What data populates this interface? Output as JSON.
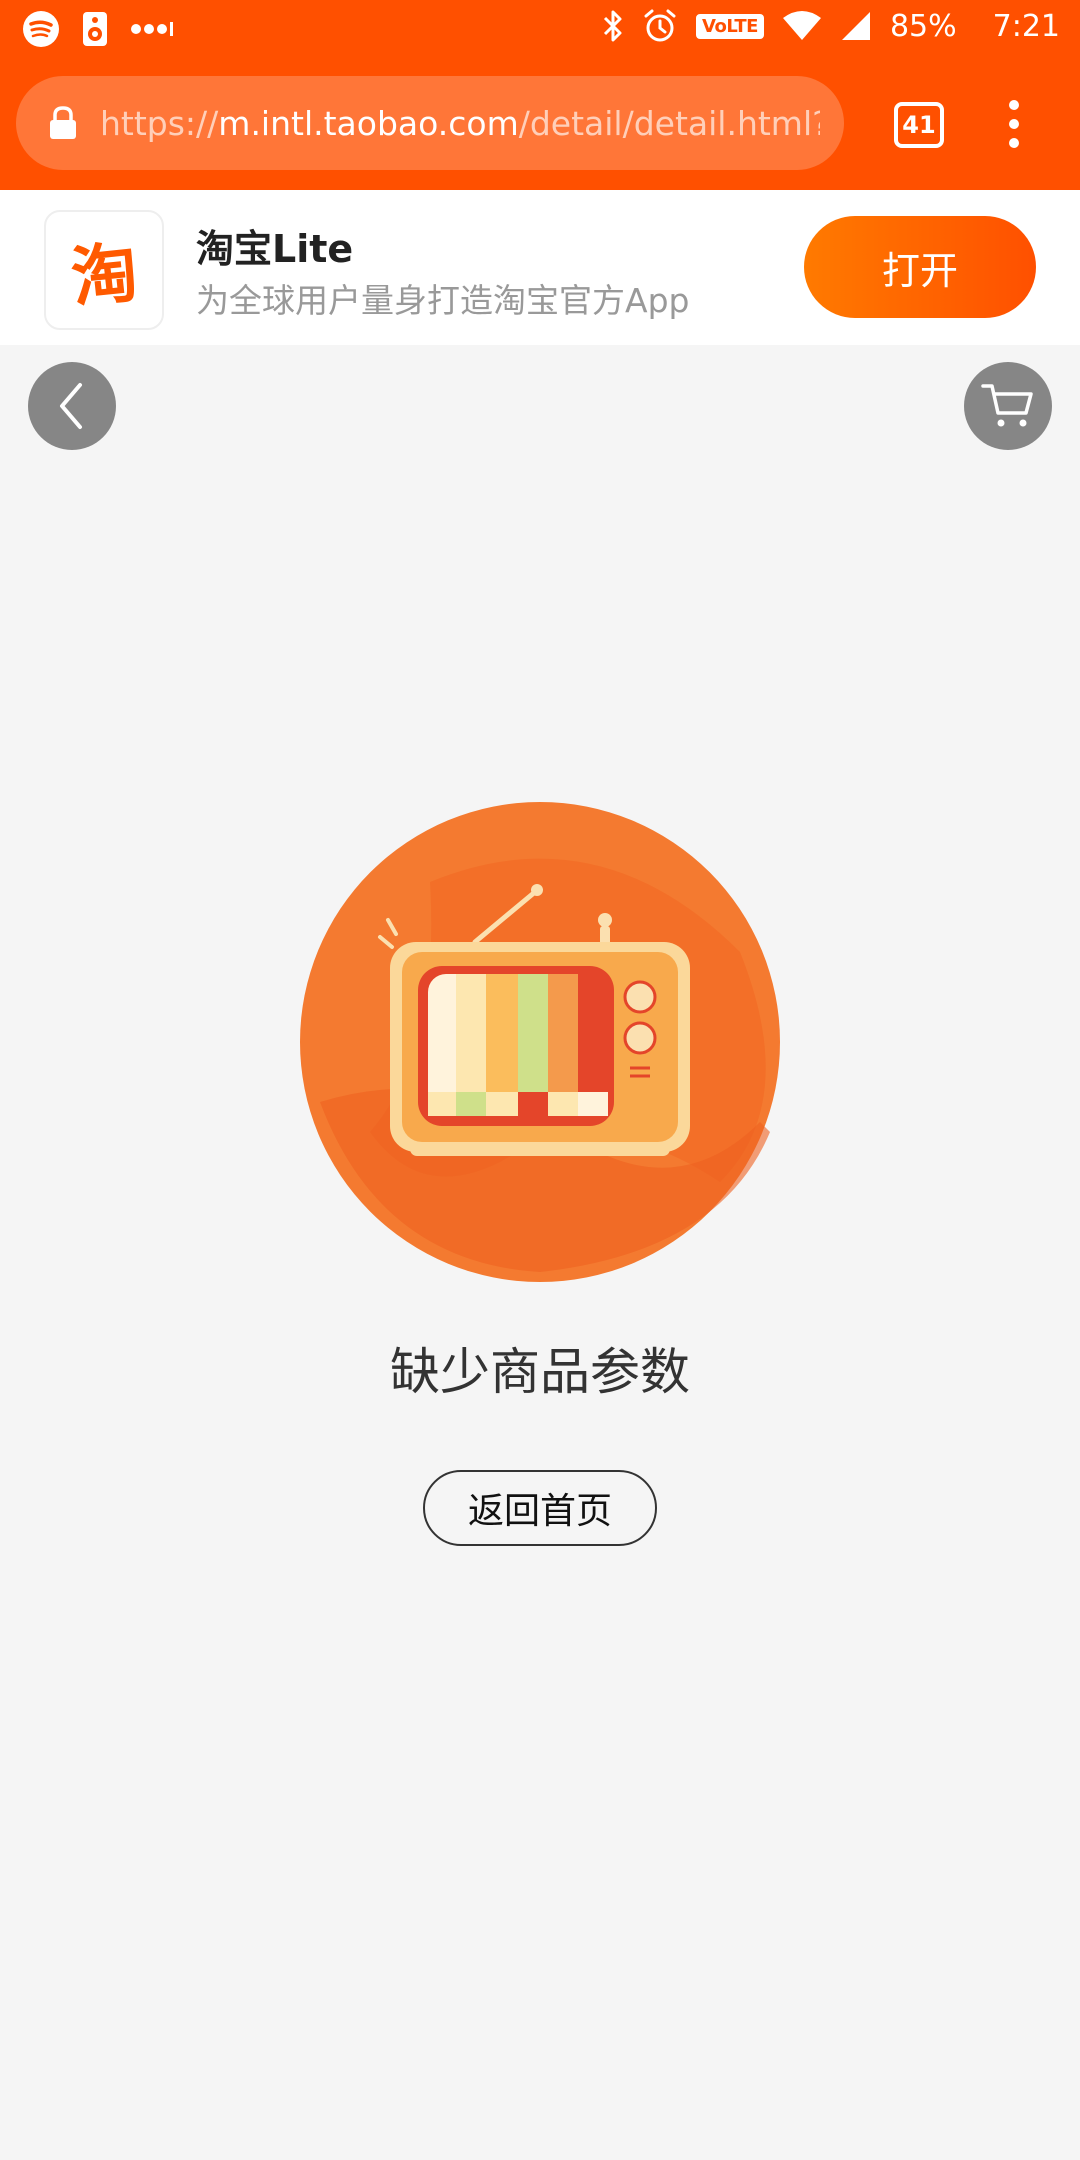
{
  "status_bar": {
    "battery": "85%",
    "time": "7:21",
    "volte": "VoLTE",
    "icons": [
      "spotify-icon",
      "speaker-icon",
      "more-dots-icon",
      "bluetooth-icon",
      "alarm-icon",
      "volte-icon",
      "wifi-icon",
      "signal-icon"
    ]
  },
  "browser": {
    "url_scheme": "https://",
    "url_domain": "m.intl.taobao.com",
    "url_path": "/detail/detail.html?spm",
    "tab_count": "41"
  },
  "app_banner": {
    "logo_char": "淘",
    "app_name": "淘宝Lite",
    "description": "为全球用户量身打造淘宝官方App",
    "open_label": "打开"
  },
  "page": {
    "error_message": "缺少商品参数",
    "home_button_label": "返回首页"
  },
  "colors": {
    "brand_orange": "#ff5000",
    "page_background": "#f5f5f5"
  }
}
